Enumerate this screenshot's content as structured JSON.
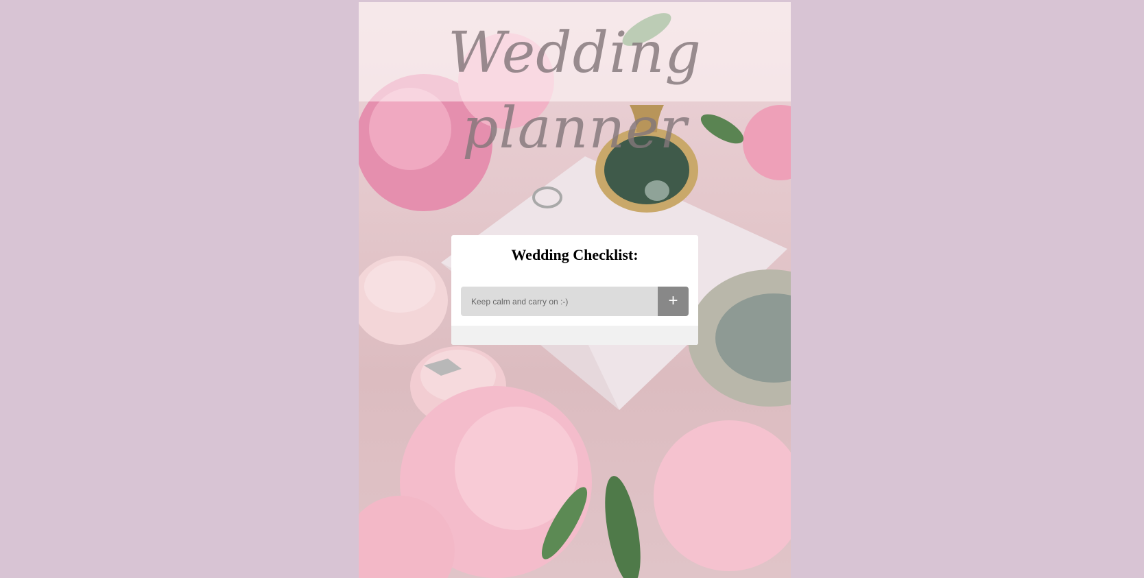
{
  "header": {
    "title": "Wedding planner"
  },
  "checklist": {
    "heading": "Wedding Checklist:",
    "input_placeholder": "Keep calm and carry on :-)",
    "input_value": "",
    "add_button_label": "+",
    "items": []
  },
  "colors": {
    "page_background": "#d8c4d4",
    "card_background": "#ffffff",
    "input_background": "#dcdcdc",
    "add_button_background": "#888888",
    "list_background": "#f1f1f1",
    "title_color": "#82767a"
  },
  "background_image": {
    "subject": "pink peonies, engagement rings in velvet boxes, envelope, hand mirror and silver tray"
  }
}
